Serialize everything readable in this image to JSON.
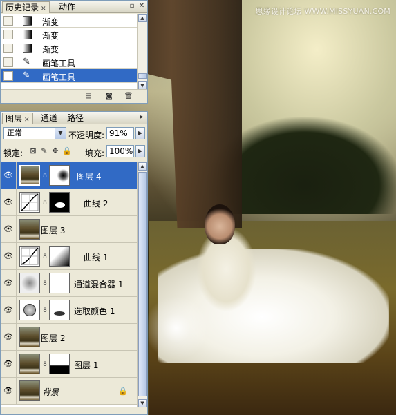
{
  "watermark": "思缘设计论坛 WWW.MISSYUAN.COM",
  "history": {
    "tabs": [
      {
        "label": "历史记录"
      },
      {
        "label": "动作"
      }
    ],
    "items": [
      {
        "label": "渐变",
        "icon": "gradient-icon"
      },
      {
        "label": "渐变",
        "icon": "gradient-icon"
      },
      {
        "label": "渐变",
        "icon": "gradient-icon"
      },
      {
        "label": "画笔工具",
        "icon": "brush-icon"
      },
      {
        "label": "画笔工具",
        "icon": "brush-icon",
        "selected": true
      }
    ],
    "footer_icons": [
      "new-document-icon",
      "camera-icon",
      "trash-icon"
    ]
  },
  "layers": {
    "tabs": [
      {
        "label": "图层"
      },
      {
        "label": "通道"
      },
      {
        "label": "路径"
      }
    ],
    "blend_mode": "正常",
    "opacity_label": "不透明度:",
    "opacity": "91%",
    "lock_label": "锁定:",
    "fill_label": "填充:",
    "fill": "100%",
    "list": [
      {
        "name": "图层 4",
        "type": "pixel",
        "has_mask": true,
        "selected": true
      },
      {
        "name": "曲线 2",
        "type": "curves",
        "has_mask": true
      },
      {
        "name": "图层 3",
        "type": "pixel",
        "has_mask": false
      },
      {
        "name": "曲线 1",
        "type": "curves",
        "has_mask": true
      },
      {
        "name": "通道混合器 1",
        "type": "channel-mixer",
        "has_mask": true
      },
      {
        "name": "选取颜色 1",
        "type": "selective-color",
        "has_mask": true
      },
      {
        "name": "图层 2",
        "type": "pixel",
        "has_mask": false
      },
      {
        "name": "图层 1",
        "type": "pixel",
        "has_mask": true
      },
      {
        "name": "背景",
        "type": "background",
        "locked": true
      }
    ]
  },
  "colors": {
    "selection": "#316ac5",
    "panel_bg": "#ece9d8",
    "panel_border": "#7f9db9"
  }
}
